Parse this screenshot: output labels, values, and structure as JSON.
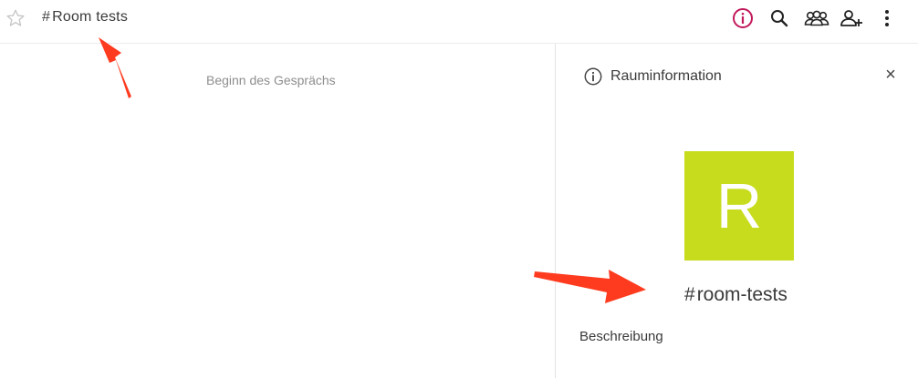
{
  "header": {
    "room_hash": "#",
    "room_name": "Room tests",
    "icons": [
      "star-icon",
      "room-info-icon",
      "search-icon",
      "members-icon",
      "invite-icon",
      "more-icon"
    ],
    "accent_color": "#c2185b"
  },
  "timeline": {
    "begin_text": "Beginn des Gesprächs"
  },
  "right_panel": {
    "title": "Rauminformation",
    "close_label": "×",
    "avatar_letter": "R",
    "avatar_color": "#c8dc1e",
    "alias_hash": "#",
    "alias": "room-tests",
    "description_label": "Beschreibung"
  },
  "annotations": {
    "arrow_color": "#ff3b1f"
  }
}
